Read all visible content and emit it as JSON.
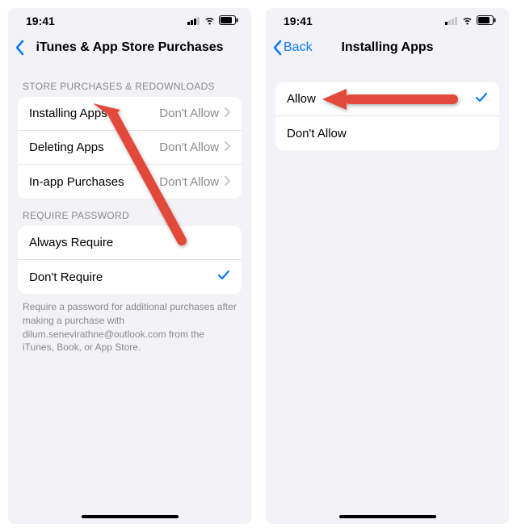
{
  "left": {
    "status": {
      "time": "19:41"
    },
    "nav": {
      "title": "iTunes & App Store Purchases"
    },
    "section1": {
      "header": "STORE PURCHASES & REDOWNLOADS",
      "rows": [
        {
          "label": "Installing Apps",
          "detail": "Don't Allow"
        },
        {
          "label": "Deleting Apps",
          "detail": "Don't Allow"
        },
        {
          "label": "In-app Purchases",
          "detail": "Don't Allow"
        }
      ]
    },
    "section2": {
      "header": "REQUIRE PASSWORD",
      "rows": [
        {
          "label": "Always Require"
        },
        {
          "label": "Don't Require"
        }
      ],
      "footer": "Require a password for additional purchases after making a purchase with dilum.senevirathne@outlook.com from the iTunes, Book, or App Store."
    }
  },
  "right": {
    "status": {
      "time": "19:41"
    },
    "nav": {
      "back": "Back",
      "title": "Installing Apps"
    },
    "rows": [
      {
        "label": "Allow"
      },
      {
        "label": "Don't Allow"
      }
    ]
  },
  "colors": {
    "accent": "#0a7aff",
    "arrow": "#e24a3a"
  }
}
